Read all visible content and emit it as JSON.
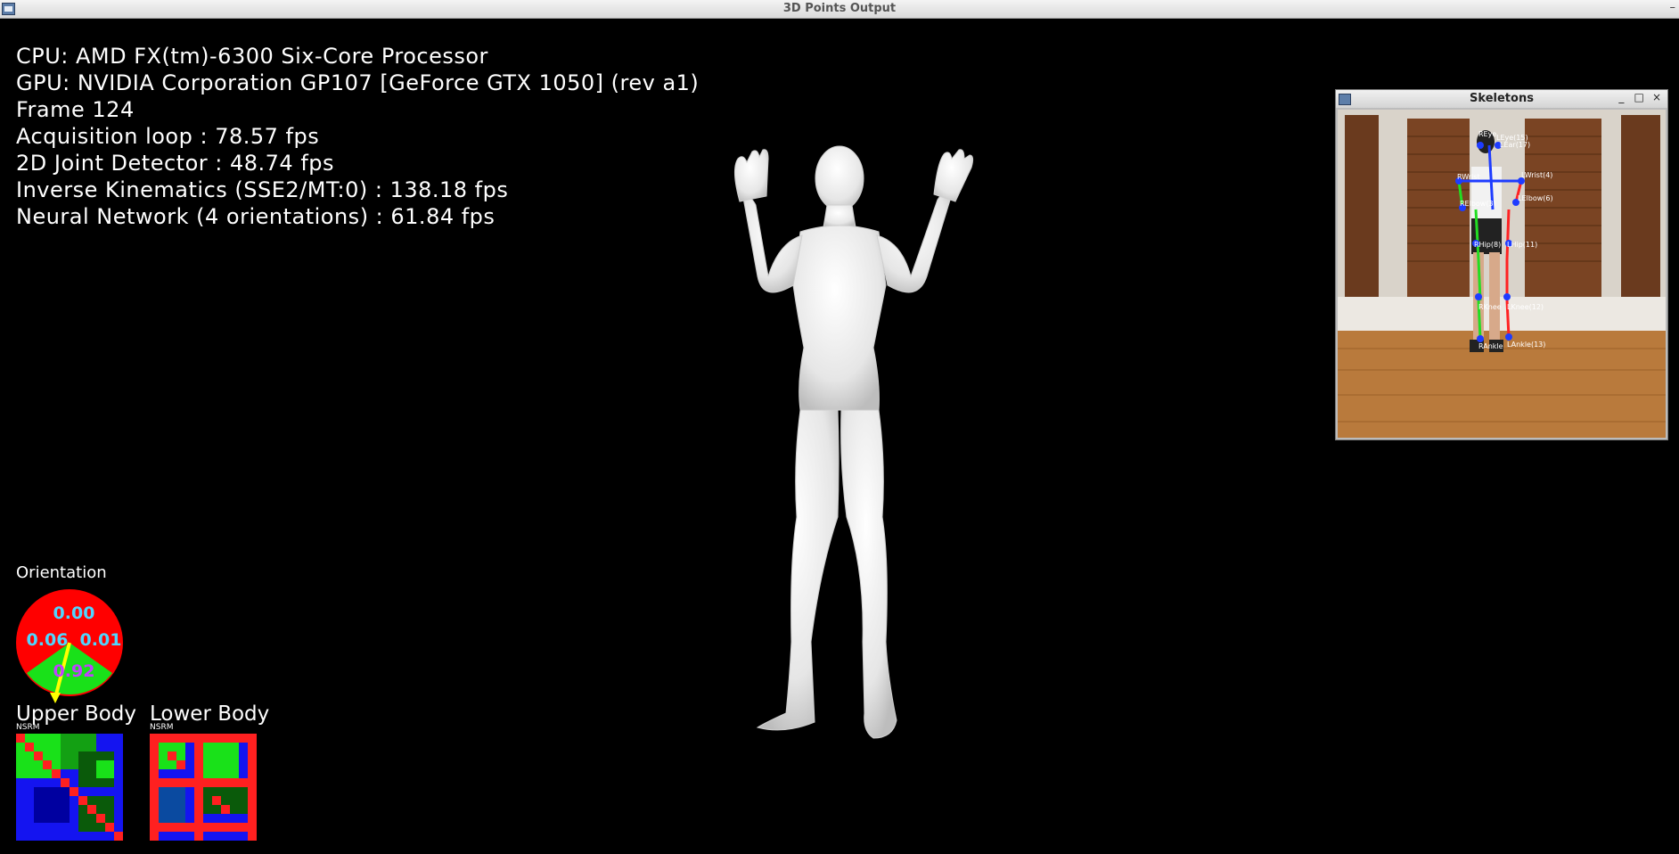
{
  "window": {
    "title": "3D Points Output",
    "minimize_glyph": "–"
  },
  "stats": [
    "CPU: AMD FX(tm)-6300 Six-Core Processor",
    "GPU: NVIDIA Corporation GP107 [GeForce GTX 1050] (rev a1)",
    "Frame 124",
    "Acquisition loop : 78.57 fps",
    "2D Joint Detector : 48.74 fps",
    "Inverse Kinematics (SSE2/MT:0) : 138.18 fps",
    "Neural Network (4 orientations) : 61.84 fps"
  ],
  "skeletons_window": {
    "title": "Skeletons",
    "buttons": [
      "_",
      "□",
      "×"
    ],
    "joint_labels": [
      "RElbow(3)",
      "LElbow(6)",
      "RHip(8)",
      "LHip(11)",
      "RKnee",
      "LKnee(12)",
      "RAnkle",
      "LAnkle(13)",
      "REye",
      "LEye(15)",
      "LEar(17)",
      "RWrist",
      "LWrist(4)"
    ]
  },
  "orientation": {
    "label": "Orientation",
    "values": {
      "top": "0.00",
      "left": "0.06",
      "right": "0.01",
      "bottom": "0.92"
    },
    "colors": {
      "pie": "#ff0000",
      "wedge": "#19e119",
      "value_text": "#4fd6ff",
      "winner_text": "#c040ff",
      "arrow": "#ffff00"
    }
  },
  "upper_body": {
    "label": "Upper Body",
    "tag": "NSRM"
  },
  "lower_body": {
    "label": "Lower Body",
    "tag": "NSRM"
  }
}
